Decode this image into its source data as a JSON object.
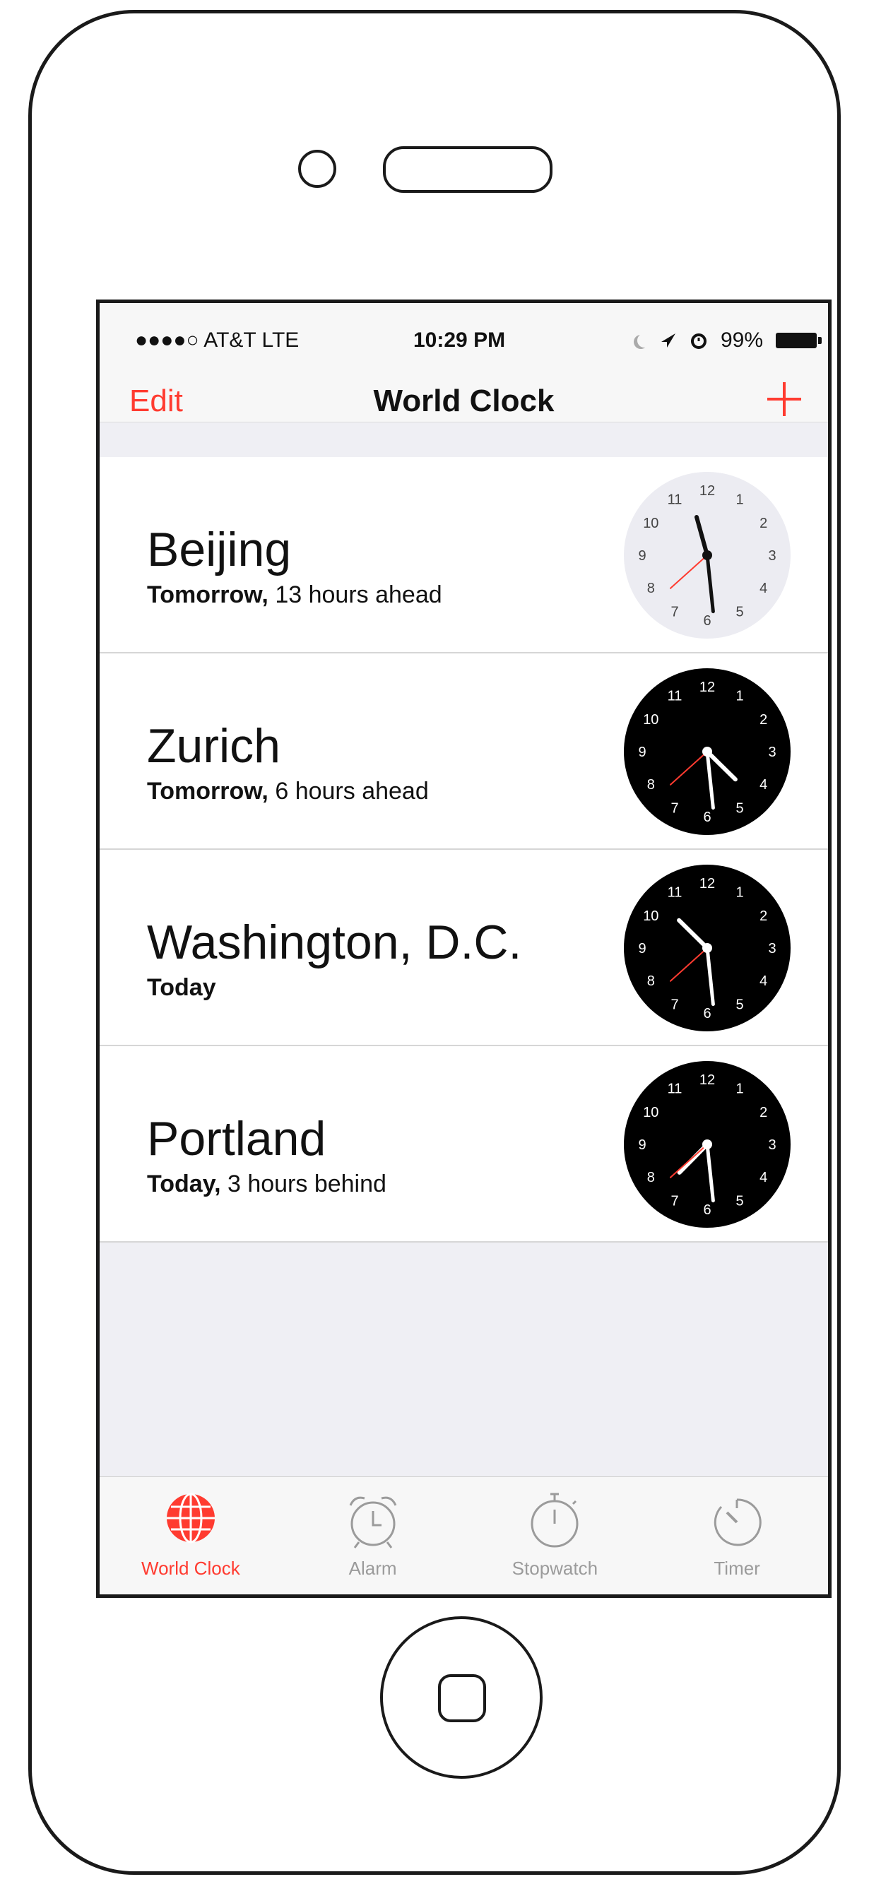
{
  "status_bar": {
    "carrier": "●●●●○ AT&T  LTE",
    "time": "10:29 PM",
    "battery": "99%"
  },
  "nav": {
    "edit_label": "Edit",
    "title": "World Clock",
    "add_icon": "plus-icon"
  },
  "clocks": [
    {
      "city": "Beijing",
      "day": "Tomorrow,",
      "offset": " 13 hours ahead",
      "face": "light",
      "time": "11:29",
      "second": 38
    },
    {
      "city": "Zurich",
      "day": "Tomorrow,",
      "offset": " 6 hours ahead",
      "face": "dark",
      "time": "4:29",
      "second": 38
    },
    {
      "city": "Washington, D.C.",
      "day": "Today",
      "offset": "",
      "face": "dark",
      "time": "10:29",
      "second": 38
    },
    {
      "city": "Portland",
      "day": "Today,",
      "offset": " 3 hours behind",
      "face": "dark",
      "time": "7:29",
      "second": 38
    }
  ],
  "tabs": [
    {
      "label": "World Clock",
      "icon": "globe-icon",
      "active": true
    },
    {
      "label": "Alarm",
      "icon": "alarm-clock-icon",
      "active": false
    },
    {
      "label": "Stopwatch",
      "icon": "stopwatch-icon",
      "active": false
    },
    {
      "label": "Timer",
      "icon": "timer-icon",
      "active": false
    }
  ],
  "colors": {
    "accent": "#ff3b30",
    "inactive_tab": "#9b9b9b",
    "dark_face": "#000000",
    "light_face": "#ececf2"
  }
}
